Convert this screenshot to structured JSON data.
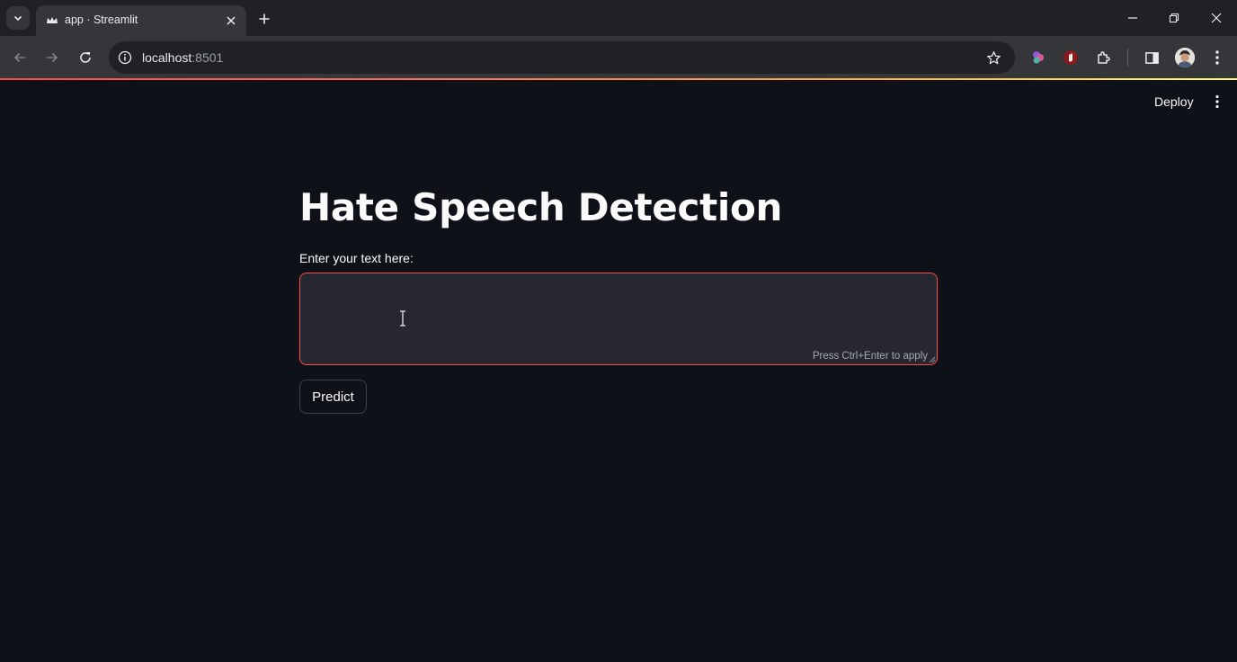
{
  "browser": {
    "tab": {
      "title": "app · Streamlit",
      "favicon": "streamlit-crown-icon"
    },
    "address_bar": {
      "host": "localhost",
      "port": ":8501"
    },
    "icons": {
      "tab_search": "chevron-down-icon",
      "close_tab": "close-icon",
      "new_tab": "plus-icon",
      "minimize": "minimize-icon",
      "restore": "restore-icon",
      "close_window": "close-icon",
      "back": "arrow-left-icon",
      "forward": "arrow-right-icon",
      "reload": "reload-icon",
      "site_info": "info-icon",
      "bookmark": "star-icon",
      "extensions": [
        "color-extension-icon",
        "red-hand-extension-icon",
        "puzzle-icon"
      ],
      "side_panel": "side-panel-icon",
      "profile": "avatar",
      "menu": "kebab-icon"
    },
    "colors": {
      "tabbar_bg": "#202124",
      "toolbar_bg": "#35363a",
      "loading_accent": "#ff4b4b"
    }
  },
  "app": {
    "header": {
      "deploy_label": "Deploy",
      "menu_icon": "kebab-icon"
    },
    "title": "Hate Speech Detection",
    "input": {
      "label": "Enter your text here:",
      "value": "",
      "hint": "Press Ctrl+Enter to apply"
    },
    "predict_label": "Predict",
    "colors": {
      "background": "#0e1117",
      "input_bg": "#262730",
      "focus_border": "#ff4b4b",
      "text": "#fafafa"
    }
  }
}
